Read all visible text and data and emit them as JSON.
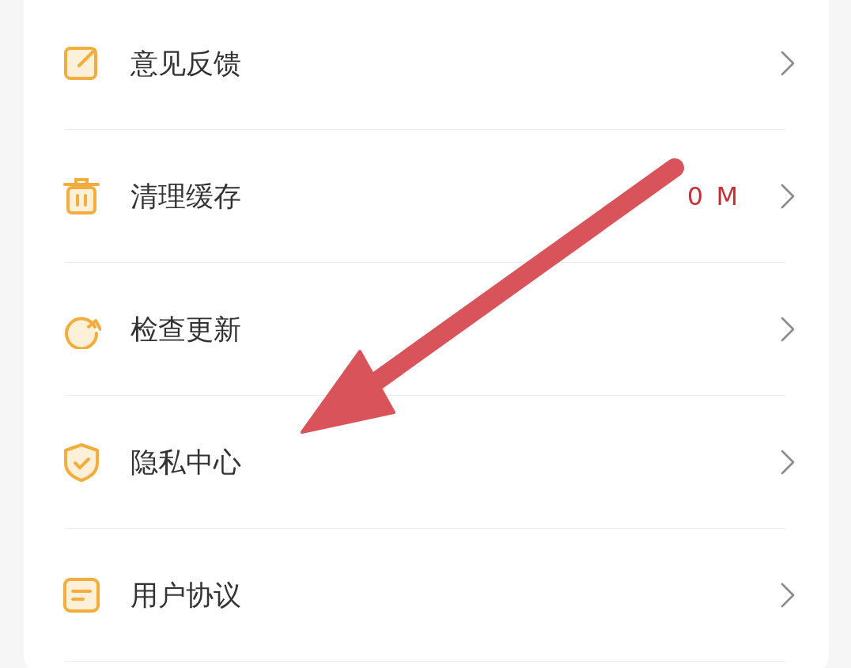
{
  "items": [
    {
      "kind": "feedback",
      "label": "意见反馈"
    },
    {
      "kind": "cache",
      "label": "清理缓存",
      "value": "0 M"
    },
    {
      "kind": "update",
      "label": "检查更新"
    },
    {
      "kind": "privacy",
      "label": "隐私中心"
    },
    {
      "kind": "agreement",
      "label": "用户协议"
    }
  ]
}
